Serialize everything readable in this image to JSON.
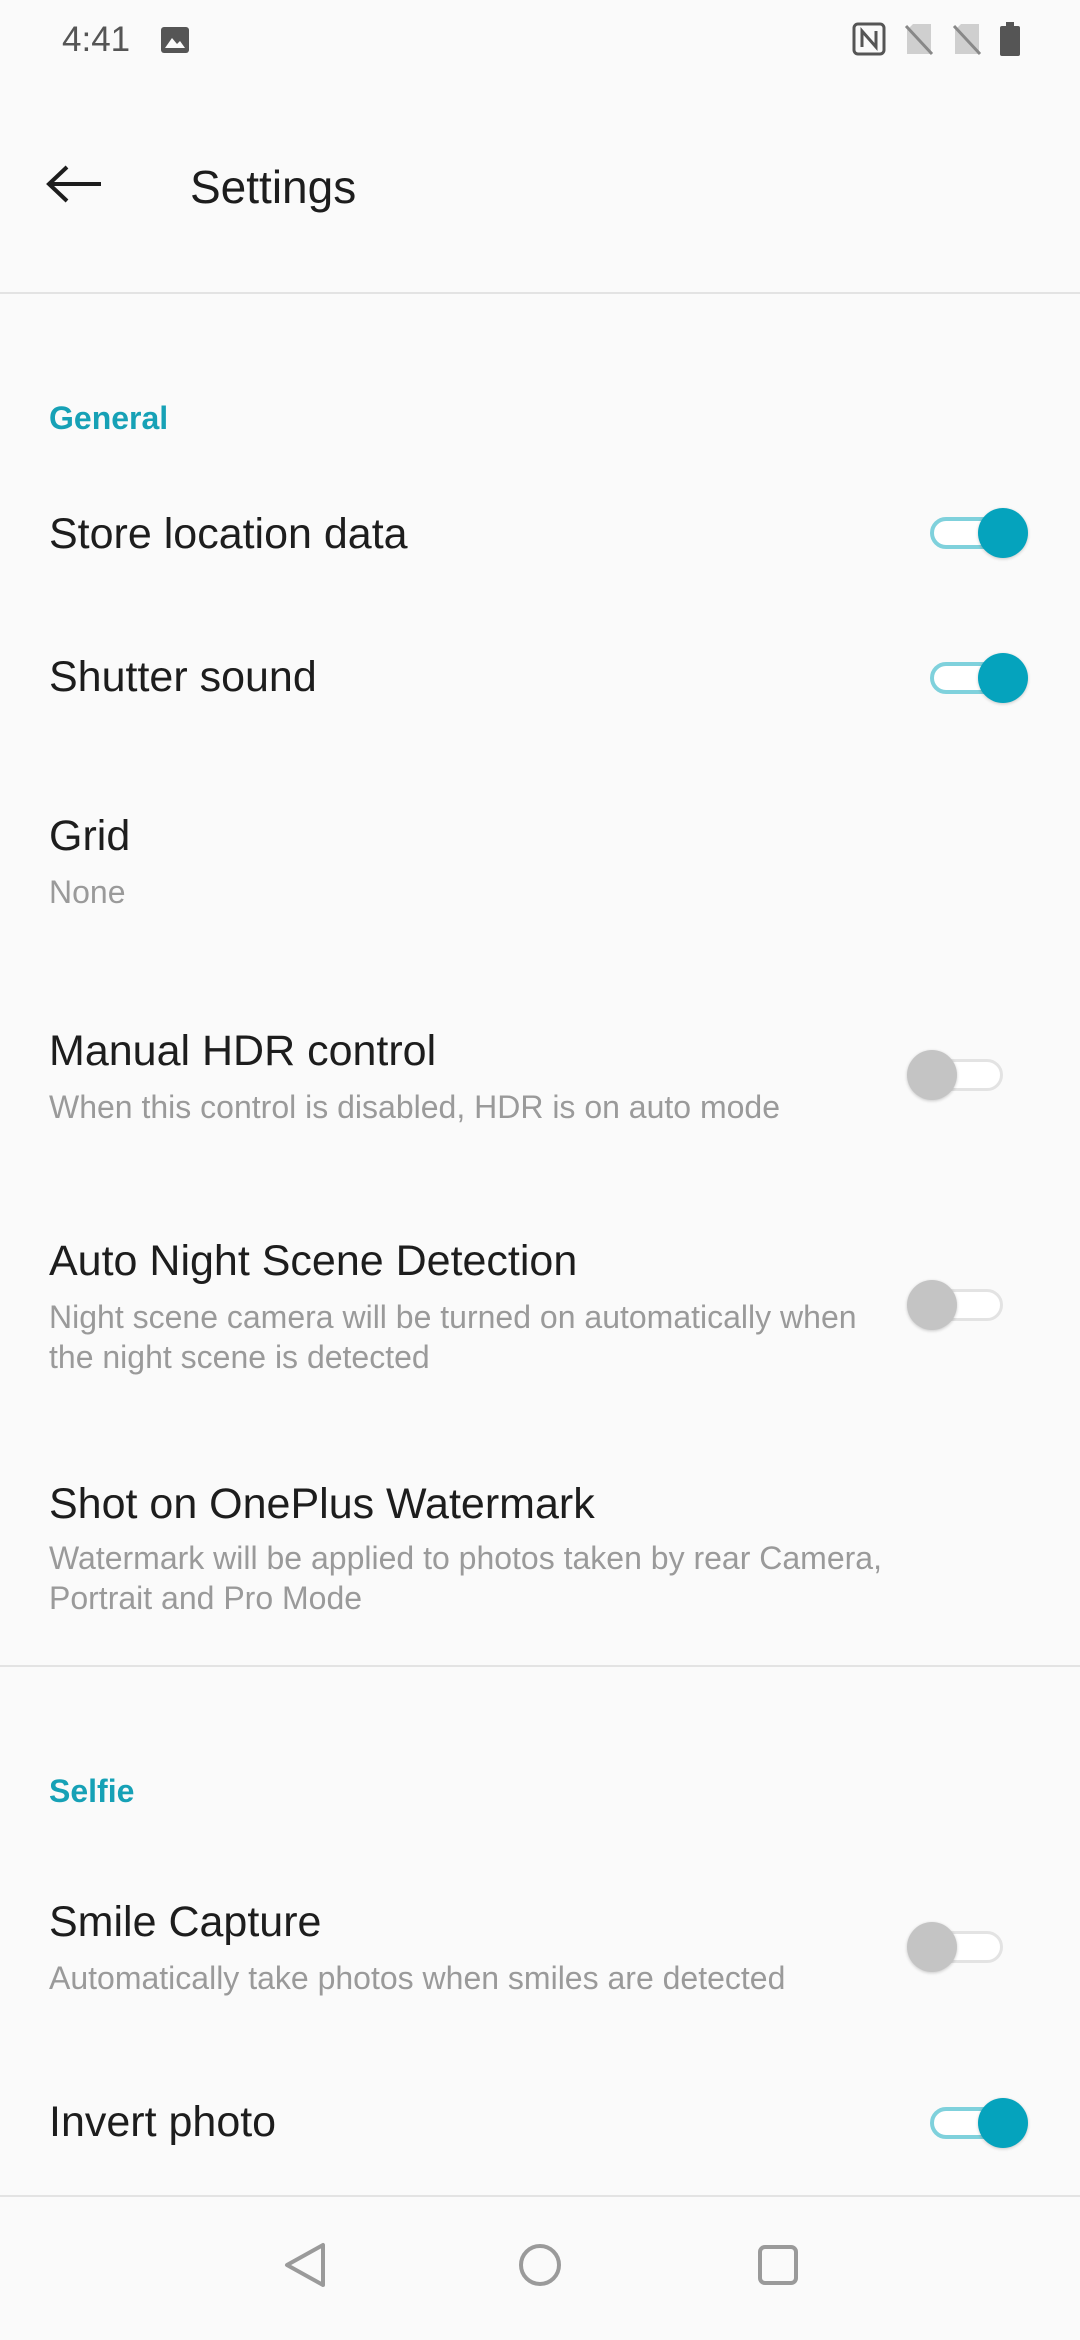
{
  "status_bar": {
    "time": "4:41",
    "icons": [
      "gallery-icon",
      "nfc-icon",
      "no-sim-icon",
      "no-sim-icon",
      "battery-icon"
    ]
  },
  "app_bar": {
    "title": "Settings",
    "back_icon": "arrow-left-icon"
  },
  "sections": {
    "general": {
      "header": "General",
      "store_location": {
        "title": "Store location data",
        "enabled": true
      },
      "shutter_sound": {
        "title": "Shutter sound",
        "enabled": true
      },
      "grid": {
        "title": "Grid",
        "value": "None"
      },
      "manual_hdr": {
        "title": "Manual HDR control",
        "subtitle": "When this control is disabled, HDR is on auto mode",
        "enabled": false
      },
      "auto_night": {
        "title": "Auto Night Scene Detection",
        "subtitle": "Night scene camera will be turned on automatically when the night scene is detected",
        "enabled": false
      },
      "watermark": {
        "title": "Shot on OnePlus Watermark",
        "subtitle": "Watermark will be applied to photos taken by rear Camera, Portrait and Pro Mode"
      }
    },
    "selfie": {
      "header": "Selfie",
      "smile_capture": {
        "title": "Smile Capture",
        "subtitle": "Automatically take photos when smiles are detected",
        "enabled": false
      },
      "invert_photo": {
        "title": "Invert photo",
        "enabled": true
      }
    }
  },
  "colors": {
    "accent": "#16a1b6",
    "toggle_on": "#05a3bd",
    "toggle_off": "#c4c4c4"
  },
  "nav_bar": {
    "icons": [
      "back-triangle-icon",
      "home-circle-icon",
      "recents-square-icon"
    ]
  }
}
